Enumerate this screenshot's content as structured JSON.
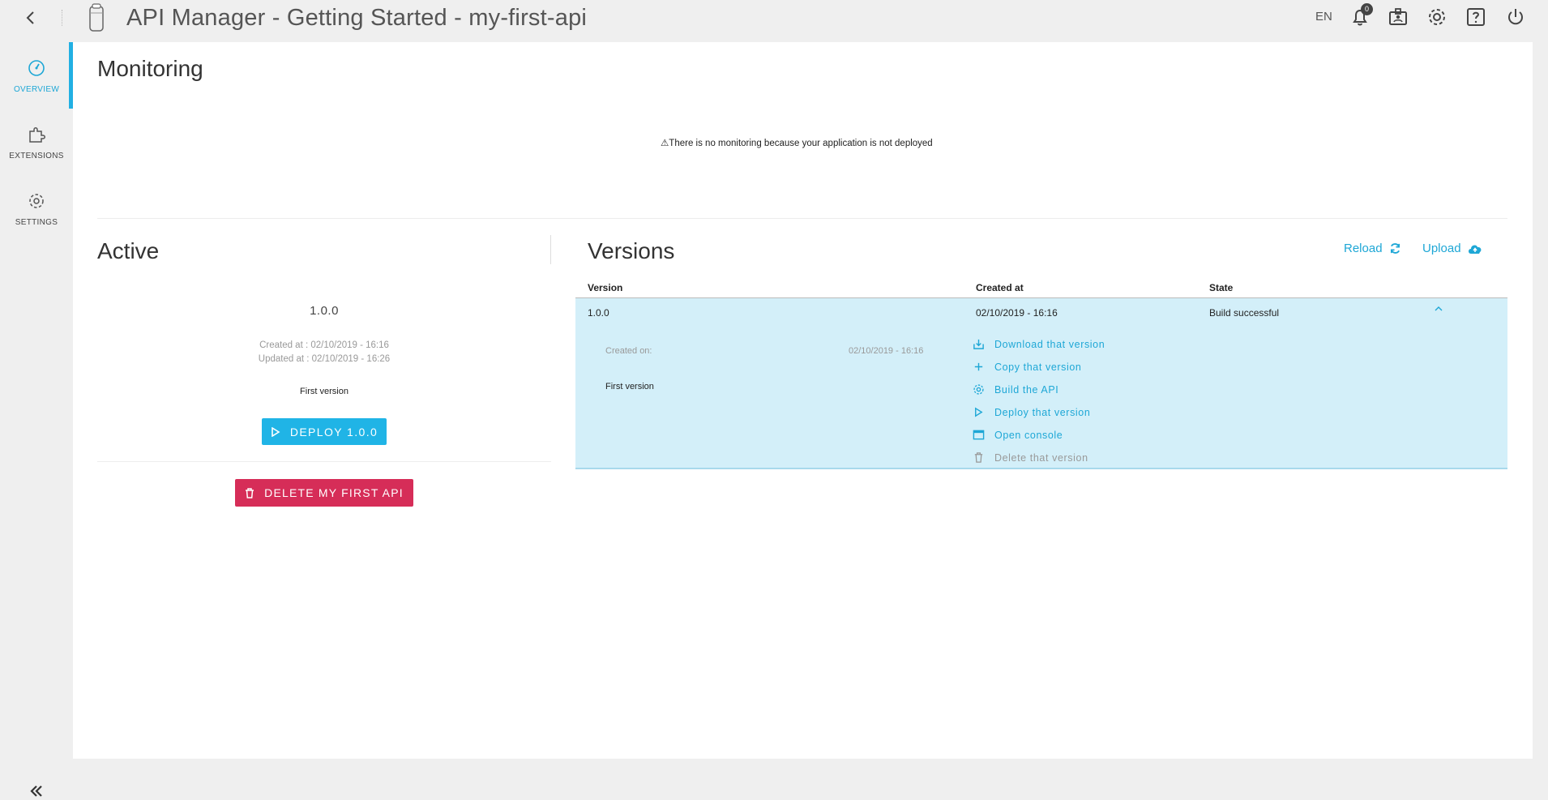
{
  "header": {
    "title": "API Manager - Getting Started - my-first-api",
    "language": "EN",
    "notification_count": "0"
  },
  "sidebar": {
    "items": [
      {
        "label": "OVERVIEW",
        "icon": "gauge-icon",
        "active": true
      },
      {
        "label": "EXTENSIONS",
        "icon": "puzzle-icon",
        "active": false
      },
      {
        "label": "SETTINGS",
        "icon": "gear-icon",
        "active": false
      }
    ]
  },
  "monitoring": {
    "title": "Monitoring",
    "message": "⚠There is no monitoring because your application is not deployed"
  },
  "active": {
    "title": "Active",
    "version": "1.0.0",
    "created": "Created at : 02/10/2019 - 16:16",
    "updated": "Updated at : 02/10/2019 - 16:26",
    "description": "First version",
    "deploy_label": "DEPLOY 1.0.0",
    "delete_label": "DELETE MY FIRST API"
  },
  "versions": {
    "title": "Versions",
    "reload_label": "Reload",
    "upload_label": "Upload",
    "columns": [
      "Version",
      "Created at",
      "State"
    ],
    "rows": [
      {
        "version": "1.0.0",
        "created_at": "02/10/2019 - 16:16",
        "state": "Build successful",
        "detail_created_label": "Created on:",
        "detail_created_value": "02/10/2019 - 16:16",
        "detail_description": "First version",
        "actions": [
          {
            "label": "Download that version",
            "icon": "download-icon",
            "enabled": true
          },
          {
            "label": "Copy that version",
            "icon": "plus-icon",
            "enabled": true
          },
          {
            "label": "Build the API",
            "icon": "gear-icon",
            "enabled": true
          },
          {
            "label": "Deploy that version",
            "icon": "play-icon",
            "enabled": true
          },
          {
            "label": "Open console",
            "icon": "console-icon",
            "enabled": true
          },
          {
            "label": "Delete that version",
            "icon": "trash-icon",
            "enabled": false
          }
        ]
      }
    ]
  },
  "colors": {
    "accent": "#1ea7d6",
    "deploy_button": "#20b4e6",
    "delete_button": "#d62d58",
    "expanded_row": "#d3eff9"
  }
}
